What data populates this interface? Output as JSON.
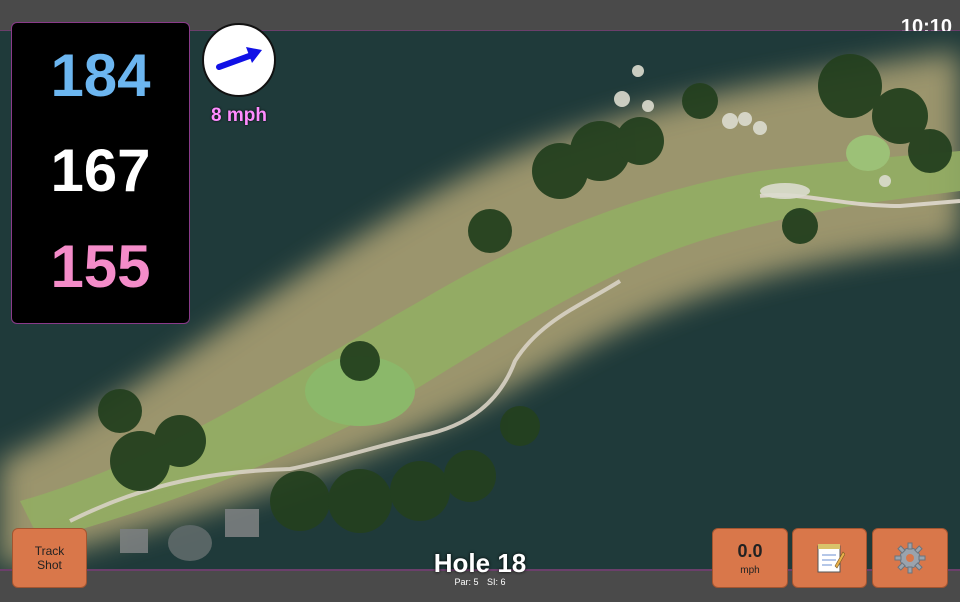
{
  "status_bar": {
    "time": "10:10"
  },
  "yardages": {
    "back": "184",
    "middle": "167",
    "front": "155"
  },
  "colors": {
    "back": "#6cb6f0",
    "middle": "#ffffff",
    "front": "#f48cc9",
    "accent": "#d9774a",
    "wind_arrow": "#1111e6"
  },
  "wind": {
    "speed": "8 mph",
    "icon": "wind-direction-arrow"
  },
  "track_shot": {
    "line1": "Track",
    "line2": "Shot"
  },
  "hole": {
    "title": "Hole 18",
    "par": "Par: 5",
    "si": "SI: 6"
  },
  "speed_button": {
    "value": "0.0",
    "unit": "mph"
  },
  "notes_button": {
    "icon": "notepad-icon"
  },
  "settings_button": {
    "icon": "gear-icon"
  }
}
